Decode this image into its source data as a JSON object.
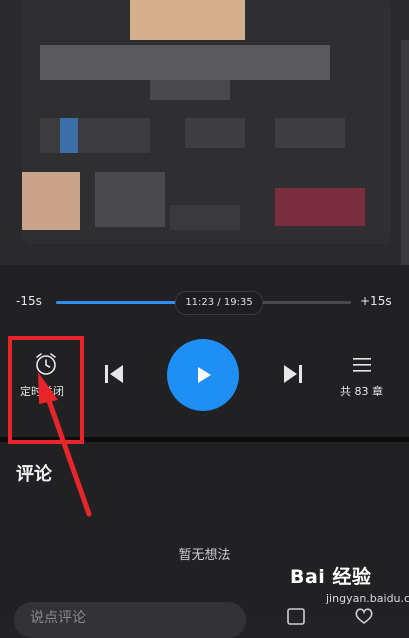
{
  "player": {
    "skip_back": "-15s",
    "skip_forward": "+15s",
    "time": "11:23 / 19:35",
    "progress_fraction": 0.408,
    "timer_label": "定时关闭",
    "chapters_label": "共 83 章",
    "accent_color": "#1e8ff5"
  },
  "comments": {
    "title": "评论",
    "empty_text": "暂无想法",
    "input_placeholder": "说点评论"
  },
  "annotation": {
    "highlight_color": "#e8252a"
  },
  "watermark": {
    "logo_text": "Bai 经验",
    "url": "jingyan.baidu.com"
  }
}
